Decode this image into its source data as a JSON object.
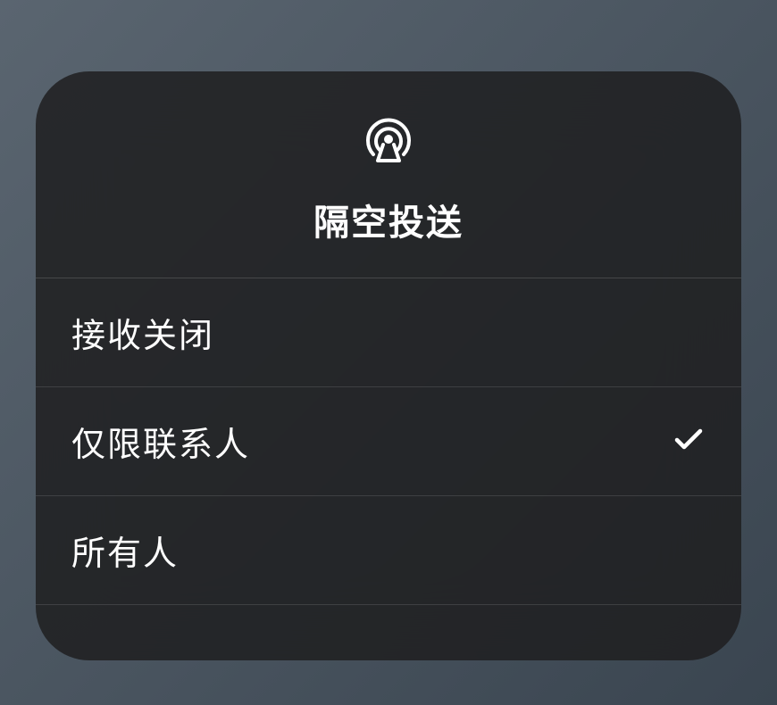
{
  "modal": {
    "title": "隔空投送",
    "options": [
      {
        "label": "接收关闭",
        "selected": false
      },
      {
        "label": "仅限联系人",
        "selected": true
      },
      {
        "label": "所有人",
        "selected": false
      }
    ]
  }
}
